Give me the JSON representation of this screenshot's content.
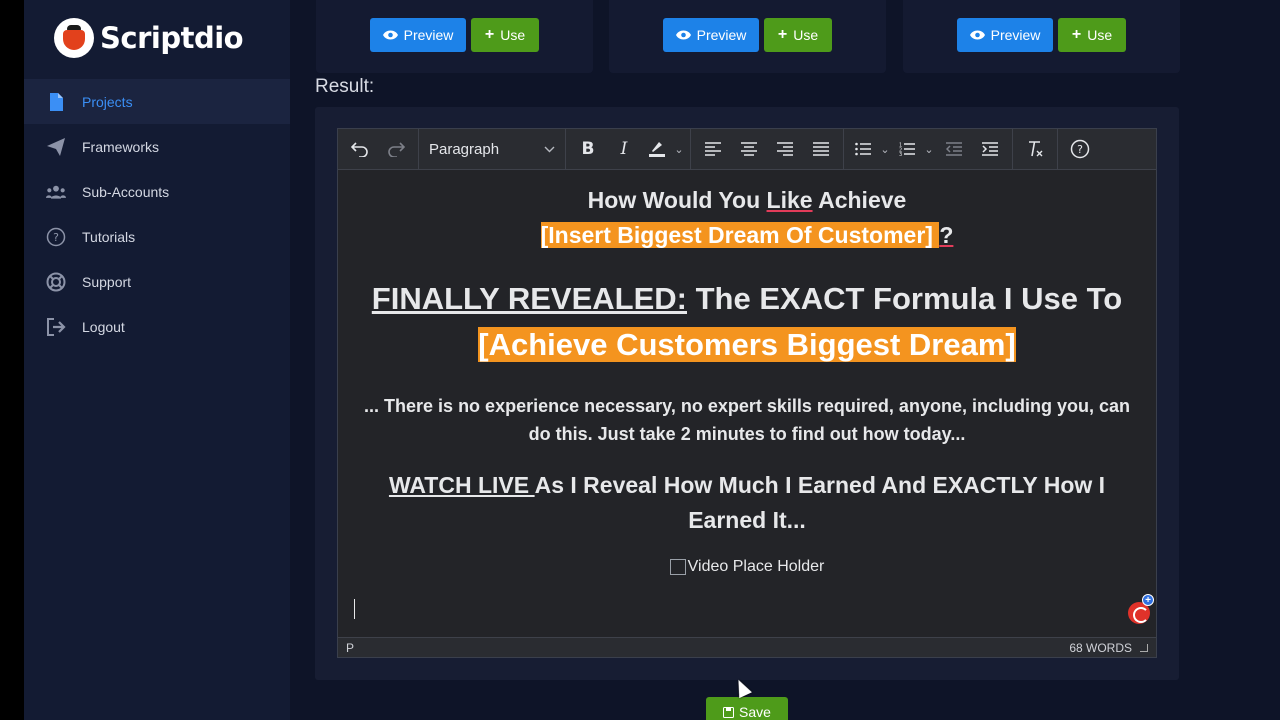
{
  "brand": {
    "name": "Scriptdio"
  },
  "sidebar": {
    "items": [
      {
        "label": "Projects",
        "icon": "document-icon",
        "active": true
      },
      {
        "label": "Frameworks",
        "icon": "paper-plane-icon"
      },
      {
        "label": "Sub-Accounts",
        "icon": "users-icon"
      },
      {
        "label": "Tutorials",
        "icon": "question-circle-icon"
      },
      {
        "label": "Support",
        "icon": "life-ring-icon"
      },
      {
        "label": "Logout",
        "icon": "sign-out-icon"
      }
    ]
  },
  "cards": [
    {
      "preview_label": "Preview",
      "use_label": "Use"
    },
    {
      "preview_label": "Preview",
      "use_label": "Use"
    },
    {
      "preview_label": "Preview",
      "use_label": "Use"
    }
  ],
  "result": {
    "label": "Result:",
    "toolbar": {
      "block_format": "Paragraph"
    },
    "content": {
      "headline1_pre": "How Would You ",
      "headline1_like": "Like",
      "headline1_mid": " Achieve ",
      "headline1_hl": "  [Insert Biggest Dream Of Customer]  ",
      "headline1_end": "?",
      "headline2_u": "FINALLY REVEALED:",
      "headline2_rest": " The EXACT Formula I Use To ",
      "headline2_hl": "  [Achieve Customers Biggest Dream]  ",
      "paragraph": "... There is no experience necessary, no expert skills required, anyone, including you, can do this.  Just take 2 minutes to find out how today...",
      "headline3_u": "WATCH LIVE ",
      "headline3_rest": "As I Reveal How Much I Earned And EXACTLY How I Earned It...",
      "video_alt": "Video Place Holder"
    },
    "status": {
      "path": "P",
      "word_count": "68 WORDS"
    }
  },
  "save_label": "Save",
  "colors": {
    "primary": "#1d82e8",
    "success": "#4e9b1a",
    "highlight": "#f4941f",
    "sidebar_bg": "#131b33",
    "active_link": "#3b8ff5"
  }
}
